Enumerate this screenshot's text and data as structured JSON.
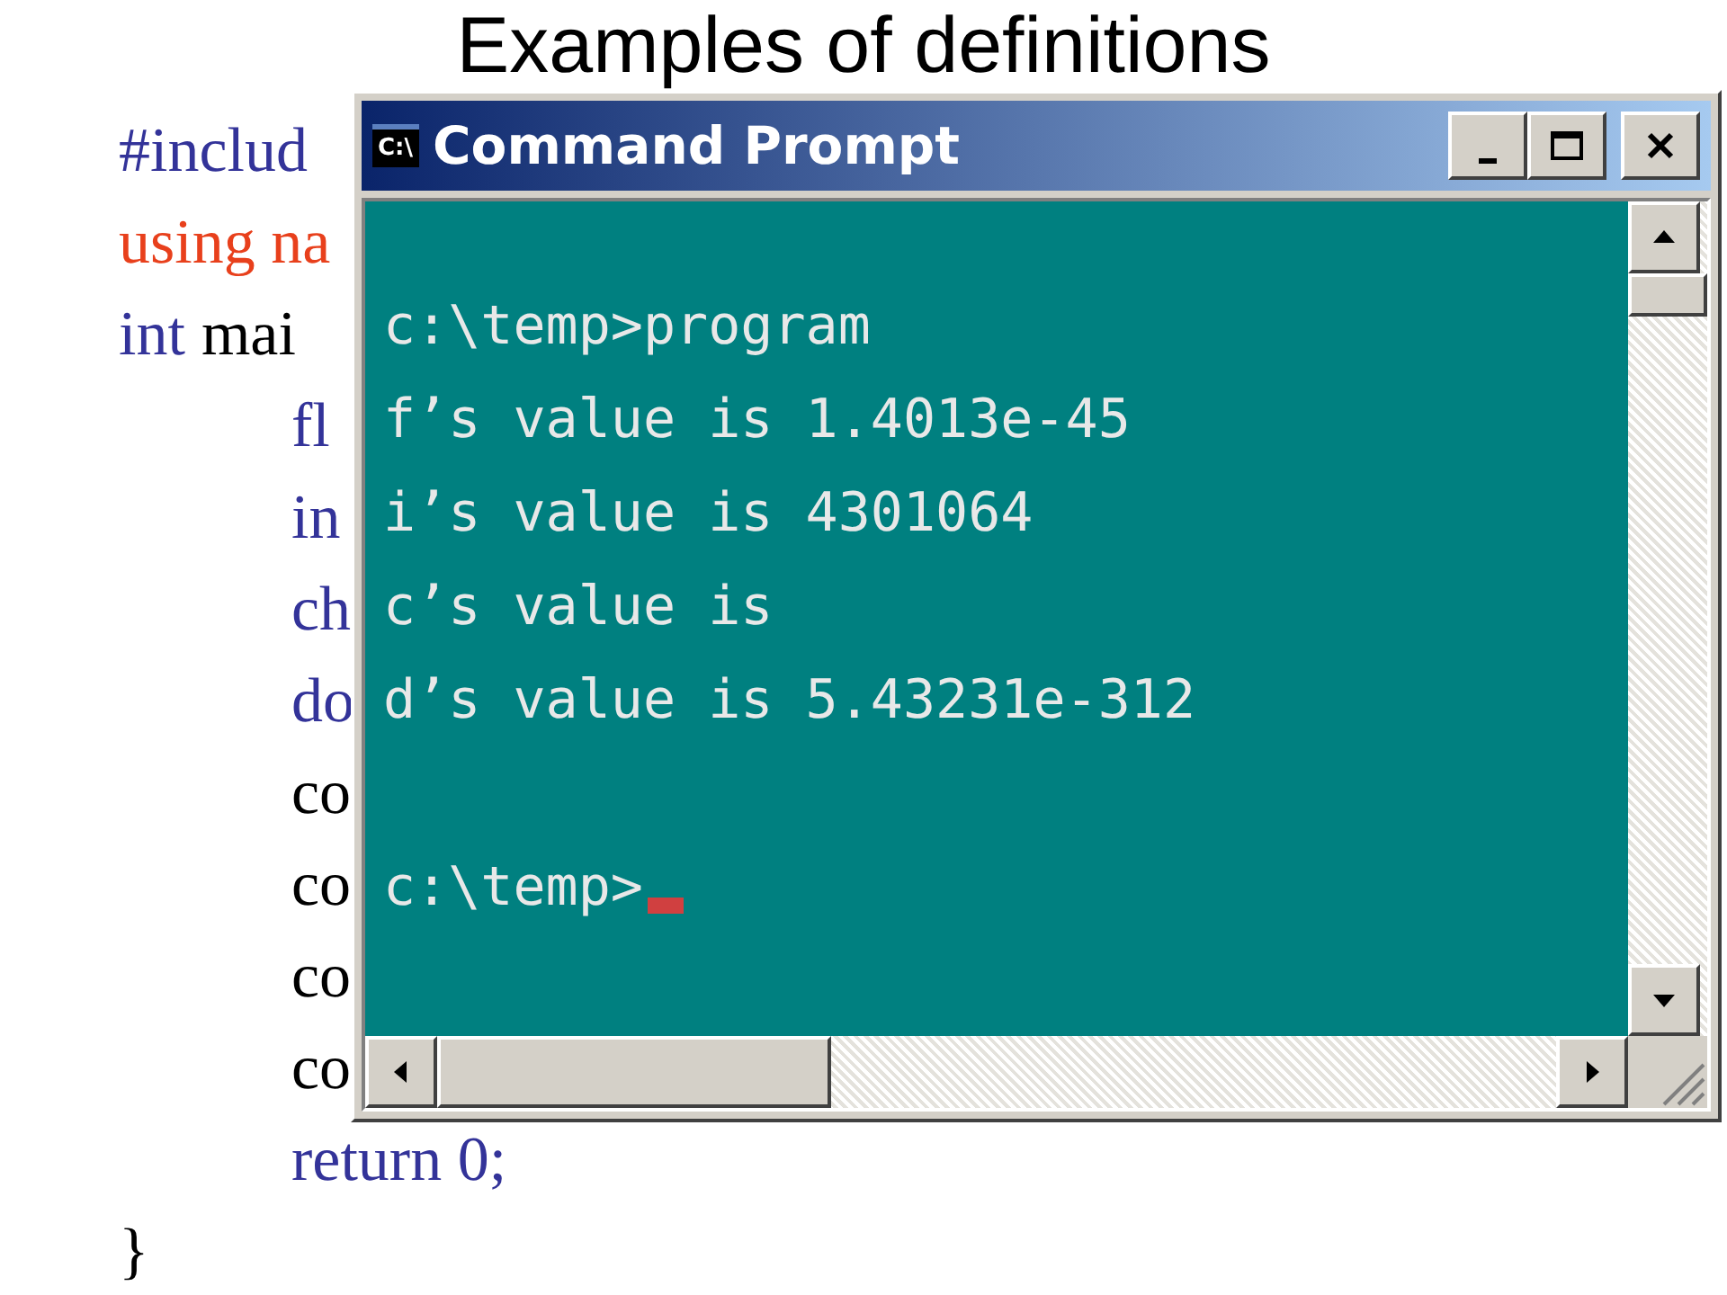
{
  "slide": {
    "title": "Examples of definitions",
    "code": [
      {
        "indent": false,
        "parts": [
          {
            "kind": "directive",
            "text": "#includ"
          }
        ]
      },
      {
        "indent": false,
        "parts": [
          {
            "kind": "namespace",
            "text": "using na"
          }
        ]
      },
      {
        "indent": false,
        "parts": [
          {
            "kind": "keyword",
            "text": "int"
          },
          {
            "kind": "plain",
            "text": "mai"
          }
        ]
      },
      {
        "indent": true,
        "parts": [
          {
            "kind": "keyword",
            "text": "fl"
          }
        ]
      },
      {
        "indent": true,
        "parts": [
          {
            "kind": "keyword",
            "text": "in"
          }
        ]
      },
      {
        "indent": true,
        "parts": [
          {
            "kind": "keyword",
            "text": "ch"
          }
        ]
      },
      {
        "indent": true,
        "parts": [
          {
            "kind": "keyword",
            "text": "do"
          }
        ]
      },
      {
        "indent": true,
        "parts": [
          {
            "kind": "plain",
            "text": "co"
          }
        ]
      },
      {
        "indent": true,
        "parts": [
          {
            "kind": "plain",
            "text": "co"
          }
        ]
      },
      {
        "indent": true,
        "parts": [
          {
            "kind": "plain",
            "text": "co"
          }
        ]
      },
      {
        "indent": true,
        "parts": [
          {
            "kind": "plain",
            "text": "co"
          }
        ]
      },
      {
        "indent": true,
        "parts": [
          {
            "kind": "keyword",
            "text": "return 0;"
          }
        ]
      },
      {
        "indent": false,
        "parts": [
          {
            "kind": "plain",
            "text": "}"
          }
        ]
      }
    ]
  },
  "window": {
    "title": "Command Prompt",
    "icon_text": "C:\\",
    "lines": [
      "c:\\temp>program",
      "f’s value is 1.4013e-45",
      "i’s value is 4301064",
      "c’s value is",
      "d’s value is 5.43231e-312"
    ],
    "prompt": "c:\\temp>"
  }
}
